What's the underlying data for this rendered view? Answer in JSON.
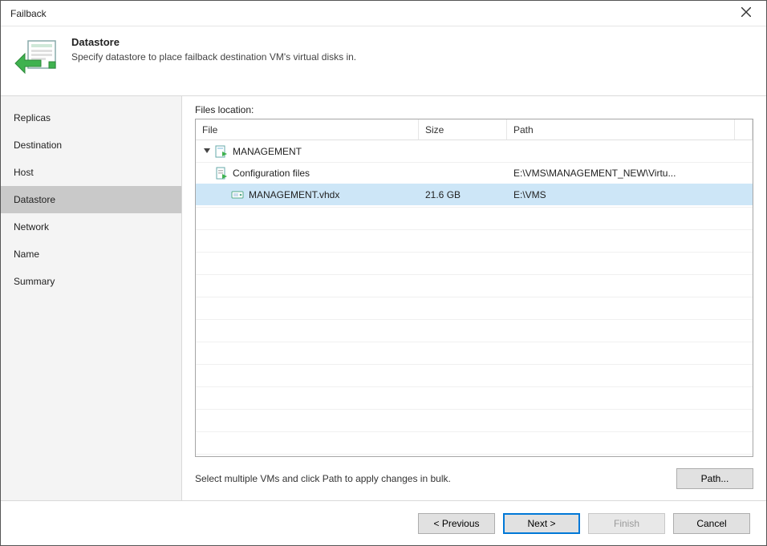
{
  "window": {
    "title": "Failback"
  },
  "header": {
    "title": "Datastore",
    "description": "Specify datastore to place failback destination VM's virtual disks in."
  },
  "sidebar": {
    "items": [
      {
        "label": "Replicas"
      },
      {
        "label": "Destination"
      },
      {
        "label": "Host"
      },
      {
        "label": "Datastore",
        "active": true
      },
      {
        "label": "Network"
      },
      {
        "label": "Name"
      },
      {
        "label": "Summary"
      }
    ]
  },
  "files": {
    "label": "Files location:",
    "columns": {
      "file": "File",
      "size": "Size",
      "path": "Path"
    },
    "rows": [
      {
        "type": "vm",
        "file": "MANAGEMENT",
        "size": "",
        "path": "",
        "level": 0,
        "expanded": true
      },
      {
        "type": "config",
        "file": "Configuration files",
        "size": "",
        "path": "E:\\VMS\\MANAGEMENT_NEW\\Virtu...",
        "level": 1
      },
      {
        "type": "disk",
        "file": "MANAGEMENT.vhdx",
        "size": "21.6 GB",
        "path": "E:\\VMS",
        "level": 1,
        "selected": true
      }
    ],
    "hint": "Select multiple VMs and click Path to apply changes in bulk.",
    "path_button": "Path..."
  },
  "footer": {
    "previous": "< Previous",
    "next": "Next >",
    "finish": "Finish",
    "cancel": "Cancel"
  }
}
